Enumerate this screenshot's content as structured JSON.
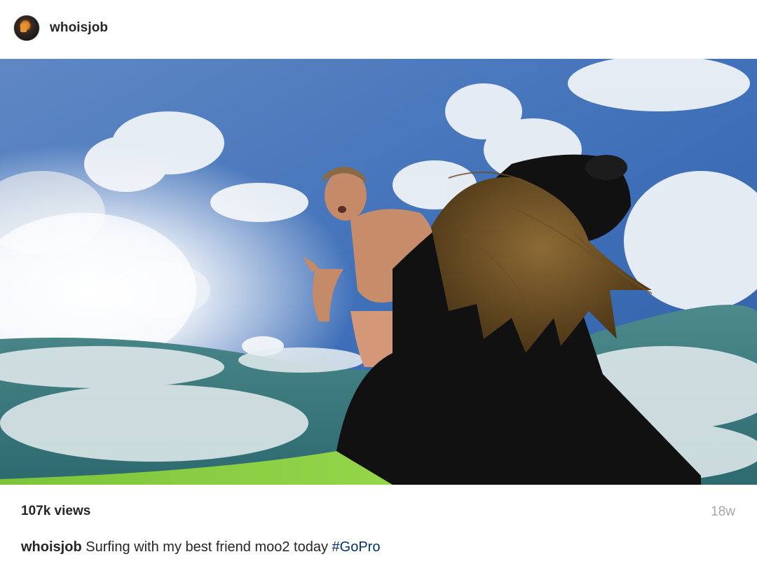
{
  "post": {
    "username": "whoisjob",
    "media": {
      "type": "photo",
      "description_icon": "photo"
    },
    "views": "107k views",
    "age": "18w",
    "caption": {
      "username": "whoisjob",
      "text": "Surfing with my best friend moo2 today",
      "hashtag": "#GoPro"
    }
  }
}
